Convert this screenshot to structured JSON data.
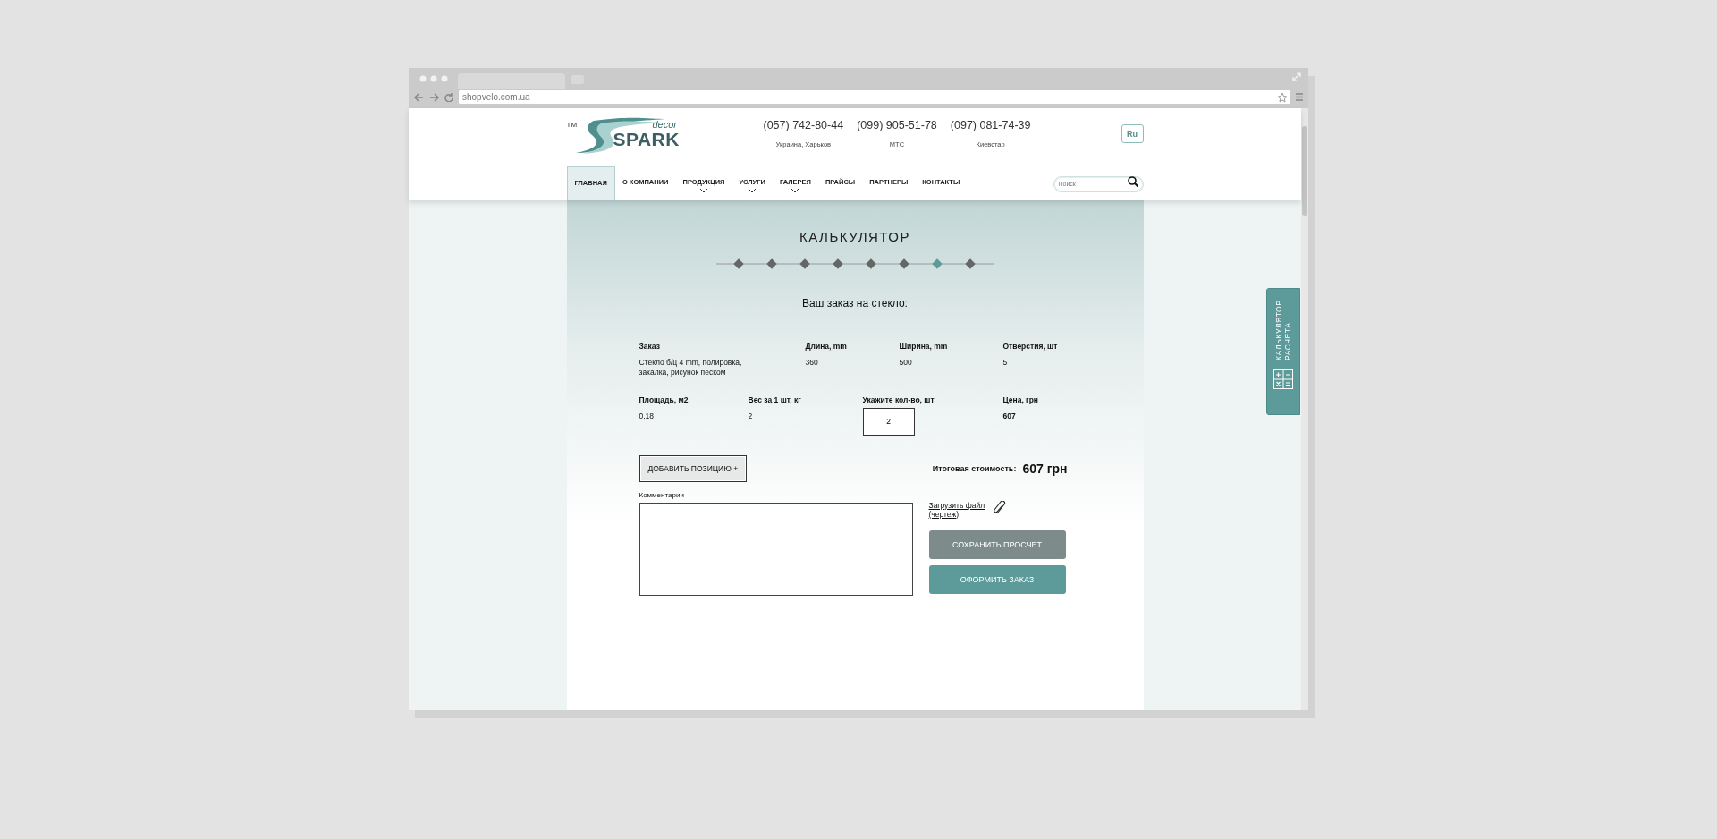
{
  "browser": {
    "url": "shopvelo.com.ua"
  },
  "header": {
    "logo": {
      "tm": "TM",
      "sub": "decor",
      "name": "SPARK"
    },
    "phones": [
      {
        "number": "(057) 742-80-44",
        "caption": "Украина, Харьков"
      },
      {
        "number": "(099) 905-51-78",
        "caption": "МТС"
      },
      {
        "number": "(097) 081-74-39",
        "caption": "Киевстар"
      }
    ],
    "language": "Ru",
    "search": {
      "placeholder": "Поиск"
    }
  },
  "nav": [
    {
      "label": "ГЛАВНАЯ",
      "selected": true,
      "dropdown": false
    },
    {
      "label": "О КОМПАНИИ",
      "selected": false,
      "dropdown": false
    },
    {
      "label": "ПРОДУКЦИЯ",
      "selected": false,
      "dropdown": true
    },
    {
      "label": "УСЛУГИ",
      "selected": false,
      "dropdown": true
    },
    {
      "label": "ГАЛЕРЕЯ",
      "selected": false,
      "dropdown": true
    },
    {
      "label": "ПРАЙСЫ",
      "selected": false,
      "dropdown": false
    },
    {
      "label": "ПАРТНЕРЫ",
      "selected": false,
      "dropdown": false
    },
    {
      "label": "КОНТАКТЫ",
      "selected": false,
      "dropdown": false
    }
  ],
  "calculator": {
    "title": "КАЛЬКУЛЯТОР",
    "steps": [
      {
        "selected": false
      },
      {
        "selected": false
      },
      {
        "selected": false
      },
      {
        "selected": false
      },
      {
        "selected": false
      },
      {
        "selected": false
      },
      {
        "selected": true
      },
      {
        "selected": false
      }
    ],
    "subtitle": "Ваш заказ на стекло:",
    "rows": [
      [
        {
          "label": "Заказ",
          "kind": "text",
          "value": "Стекло б/ц 4 mm, полировка, закалка, рисунок песком"
        },
        {
          "label": "Длина, mm",
          "kind": "text",
          "value": "360"
        },
        {
          "label": "Ширина, mm",
          "kind": "text",
          "value": "500"
        },
        {
          "label": "Отверстия, шт",
          "kind": "text",
          "value": "5"
        }
      ],
      [
        {
          "label": "Площадь, м2",
          "kind": "text",
          "value": "0,18"
        },
        {
          "label": "Вес за 1 шт, кг",
          "kind": "text",
          "value": "2"
        },
        {
          "label": "Укажите кол-во, шт",
          "kind": "input",
          "value": "2"
        },
        {
          "label": "Цена, грн",
          "kind": "bold",
          "value": "607"
        }
      ]
    ],
    "add_button": "ДОБАВИТЬ ПОЗИЦИЮ +",
    "total": {
      "label": "Итоговая стоимость:",
      "value": "607 грн"
    },
    "comment": {
      "label": "Комментарии"
    },
    "upload_link": "Загрузить файл (чертеж)",
    "save_button": "СОХРАНИТЬ ПРОСЧЕТ",
    "order_button": "ОФОРМИТЬ ЗАКАЗ"
  },
  "side_tab": {
    "title": "КАЛЬКУЛЯТОР РАСЧЕТА"
  }
}
